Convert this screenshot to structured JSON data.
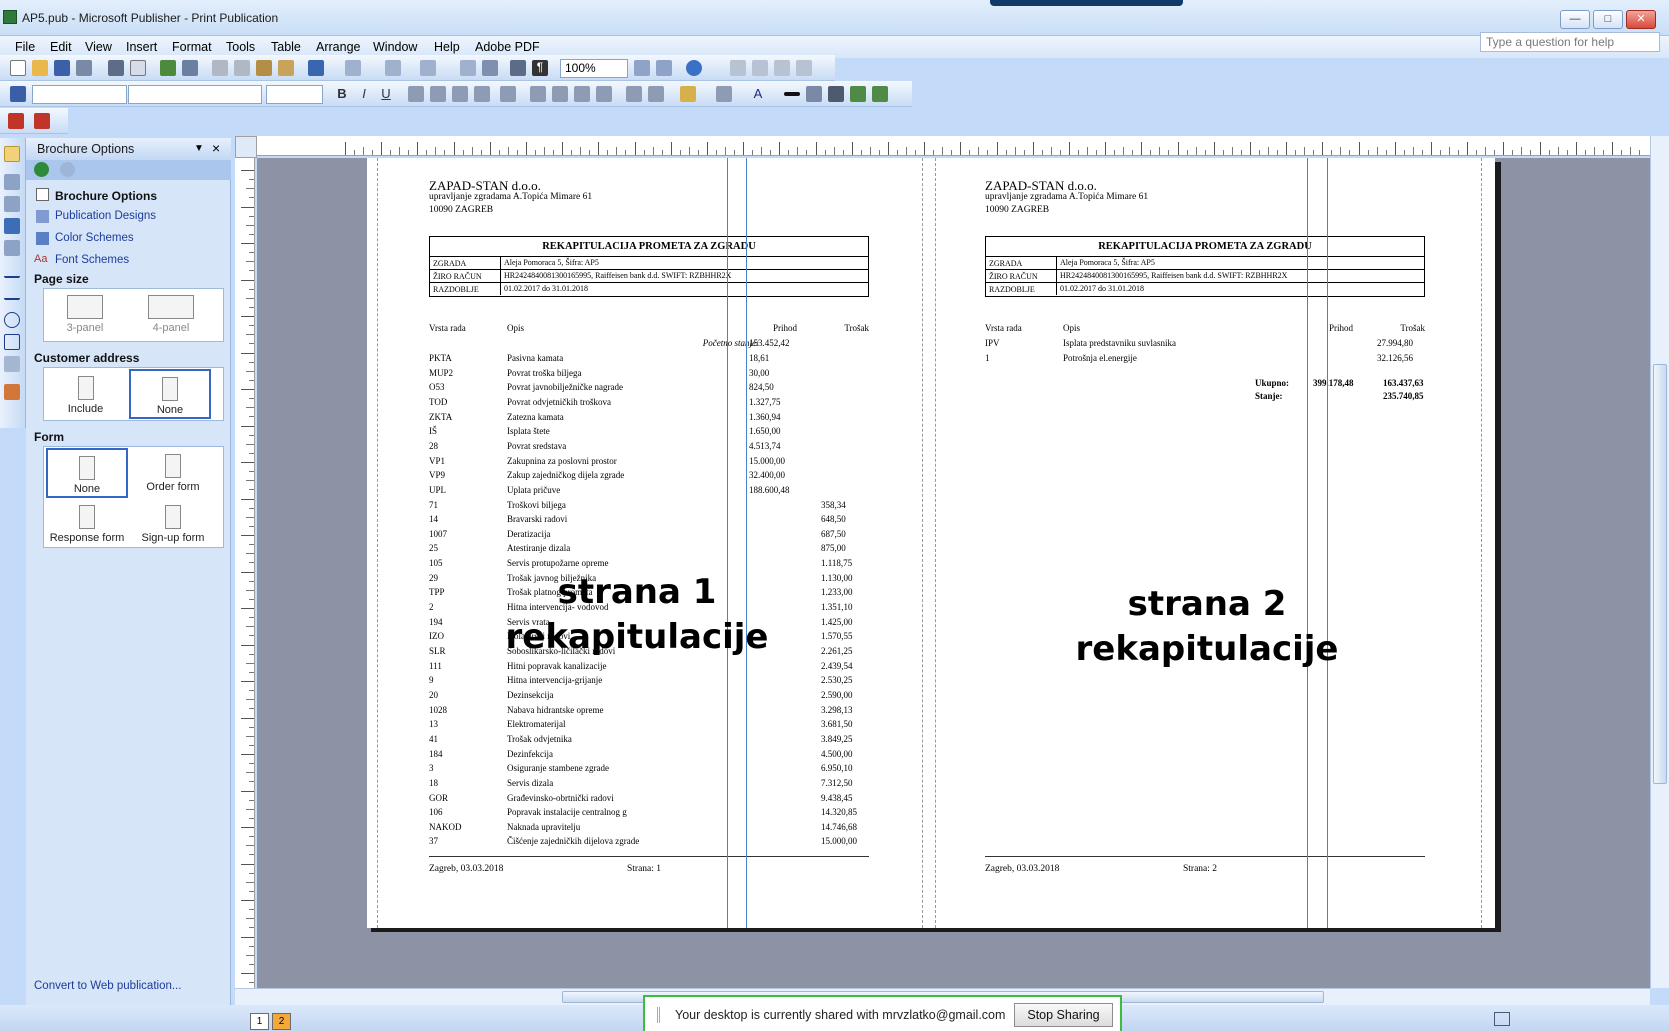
{
  "window": {
    "title": "AP5.pub - Microsoft Publisher - Print Publication",
    "minimize": "—",
    "maximize": "□",
    "close": "✕"
  },
  "menu": {
    "items": [
      "File",
      "Edit",
      "View",
      "Insert",
      "Format",
      "Tools",
      "Table",
      "Arrange",
      "Window",
      "Help",
      "Adobe PDF"
    ],
    "help_placeholder": "Type a question for help"
  },
  "toolbar": {
    "zoom": "100%"
  },
  "taskpane": {
    "title": "Brochure Options",
    "options_label": "Brochure Options",
    "links": [
      "Publication Designs",
      "Color Schemes",
      "Font Schemes"
    ],
    "page_size_label": "Page size",
    "page_size_options": [
      "3-panel",
      "4-panel"
    ],
    "customer_address_label": "Customer address",
    "customer_address_options": [
      "Include",
      "None"
    ],
    "form_label": "Form",
    "form_options": [
      "None",
      "Order form",
      "Response form",
      "Sign-up form"
    ],
    "convert_link": "Convert to Web publication..."
  },
  "doc": {
    "company": "ZAPAD-STAN d.o.o.",
    "address1": "upravljanje zgradama A.Topića Mimare 61",
    "address2": "10090 ZAGREB",
    "table_title": "REKAPITULACIJA PROMETA ZA ZGRADU",
    "table_rows": [
      {
        "key": "ZGRADA",
        "value": "Aleja Pomoraca 5,  Šifra: AP5"
      },
      {
        "key": "ŽIRO RAČUN",
        "value": "HR2424840081300165995, Raiffeisen bank d.d. SWIFT: RZBHHR2X"
      },
      {
        "key": "RAZDOBLJE",
        "value": "01.02.2017 do 31.01.2018"
      }
    ],
    "col_vrsta": "Vrsta rada",
    "col_opis": "Opis",
    "col_prihod": "Prihod",
    "col_trosak": "Trošak",
    "pocetno": "Početno stanje:",
    "pocetno_value": "153.452,42",
    "page1_lines": [
      {
        "code": "PKTA",
        "desc": "Pasivna kamata",
        "prihod": "18,61",
        "trosak": ""
      },
      {
        "code": "MUP2",
        "desc": "Povrat troška biljega",
        "prihod": "30,00",
        "trosak": ""
      },
      {
        "code": "O53",
        "desc": "Povrat javnobilježničke nagrade",
        "prihod": "824,50",
        "trosak": ""
      },
      {
        "code": "TOD",
        "desc": "Povrat odvjetničkih troškova",
        "prihod": "1.327,75",
        "trosak": ""
      },
      {
        "code": "ZKTA",
        "desc": "Zatezna kamata",
        "prihod": "1.360,94",
        "trosak": ""
      },
      {
        "code": "IŠ",
        "desc": "Isplata štete",
        "prihod": "1.650,00",
        "trosak": ""
      },
      {
        "code": "28",
        "desc": "Povrat sredstava",
        "prihod": "4.513,74",
        "trosak": ""
      },
      {
        "code": "VP1",
        "desc": "Zakupnina za poslovni prostor",
        "prihod": "15.000,00",
        "trosak": ""
      },
      {
        "code": "VP9",
        "desc": "Zakup zajedničkog dijela zgrade",
        "prihod": "32.400,00",
        "trosak": ""
      },
      {
        "code": "UPL",
        "desc": "Uplata pričuve",
        "prihod": "188.600,48",
        "trosak": ""
      },
      {
        "code": "71",
        "desc": "Troškovi biljega",
        "prihod": "",
        "trosak": "358,34"
      },
      {
        "code": "14",
        "desc": "Bravarski radovi",
        "prihod": "",
        "trosak": "648,50"
      },
      {
        "code": "1007",
        "desc": "Deratizacija",
        "prihod": "",
        "trosak": "687,50"
      },
      {
        "code": "25",
        "desc": "Atestiranje dizala",
        "prihod": "",
        "trosak": "875,00"
      },
      {
        "code": "105",
        "desc": "Servis protupožarne opreme",
        "prihod": "",
        "trosak": "1.118,75"
      },
      {
        "code": "29",
        "desc": "Trošak javnog bilježnika",
        "prihod": "",
        "trosak": "1.130,00"
      },
      {
        "code": "TPP",
        "desc": "Trošak platnog prometa",
        "prihod": "",
        "trosak": "1.233,00"
      },
      {
        "code": "2",
        "desc": "Hitna intervencija- vodovod",
        "prihod": "",
        "trosak": "1.351,10"
      },
      {
        "code": "194",
        "desc": "Servis vrata",
        "prihod": "",
        "trosak": "1.425,00"
      },
      {
        "code": "IZO",
        "desc": "Izolaterski radovi",
        "prihod": "",
        "trosak": "1.570,55"
      },
      {
        "code": "SLR",
        "desc": "Soboslikarsko-ličilački radovi",
        "prihod": "",
        "trosak": "2.261,25"
      },
      {
        "code": "111",
        "desc": "Hitni popravak kanalizacije",
        "prihod": "",
        "trosak": "2.439,54"
      },
      {
        "code": "9",
        "desc": "Hitna intervencija-grijanje",
        "prihod": "",
        "trosak": "2.530,25"
      },
      {
        "code": "20",
        "desc": "Dezinsekcija",
        "prihod": "",
        "trosak": "2.590,00"
      },
      {
        "code": "1028",
        "desc": "Nabava hidrantske opreme",
        "prihod": "",
        "trosak": "3.298,13"
      },
      {
        "code": "13",
        "desc": "Elektromaterijal",
        "prihod": "",
        "trosak": "3.681,50"
      },
      {
        "code": "41",
        "desc": "Trošak odvjetnika",
        "prihod": "",
        "trosak": "3.849,25"
      },
      {
        "code": "184",
        "desc": "Dezinfekcija",
        "prihod": "",
        "trosak": "4.500,00"
      },
      {
        "code": "3",
        "desc": "Osiguranje stambene zgrade",
        "prihod": "",
        "trosak": "6.950,10"
      },
      {
        "code": "18",
        "desc": "Servis dizala",
        "prihod": "",
        "trosak": "7.312,50"
      },
      {
        "code": "GOR",
        "desc": "Građevinsko-obrtnički radovi",
        "prihod": "",
        "trosak": "9.438,45"
      },
      {
        "code": "106",
        "desc": "Popravak instalacije centralnog g",
        "prihod": "",
        "trosak": "14.320,85"
      },
      {
        "code": "NAKOD",
        "desc": "Naknada upravitelju",
        "prihod": "",
        "trosak": "14.746,68"
      },
      {
        "code": "37",
        "desc": "Čišćenje zajedničkih dijelova zgrade",
        "prihod": "",
        "trosak": "15.000,00"
      }
    ],
    "page2_lines": [
      {
        "code": "IPV",
        "desc": "Isplata predstavniku suvlasnika",
        "trosak": "27.994,80"
      },
      {
        "code": "1",
        "desc": "Potrošnja el.energije",
        "trosak": "32.126,56"
      }
    ],
    "ukupno_label": "Ukupno:",
    "ukupno_prihod": "399.178,48",
    "ukupno_trosak": "163.437,63",
    "stanje_label": "Stanje:",
    "stanje_value": "235.740,85",
    "footer_date": "Zagreb, 03.03.2018",
    "footer_page1": "Strana: 1",
    "footer_page2": "Strana: 2",
    "overlay1_line1": "strana 1",
    "overlay1_line2": "rekapitulacije",
    "overlay2_line1": "strana 2",
    "overlay2_line2": "rekapitulacije"
  },
  "status": {
    "share_message": "Your desktop is currently shared with mrvzlatko@gmail.com",
    "stop_button": "Stop Sharing",
    "page_tabs": [
      "1",
      "2"
    ]
  }
}
